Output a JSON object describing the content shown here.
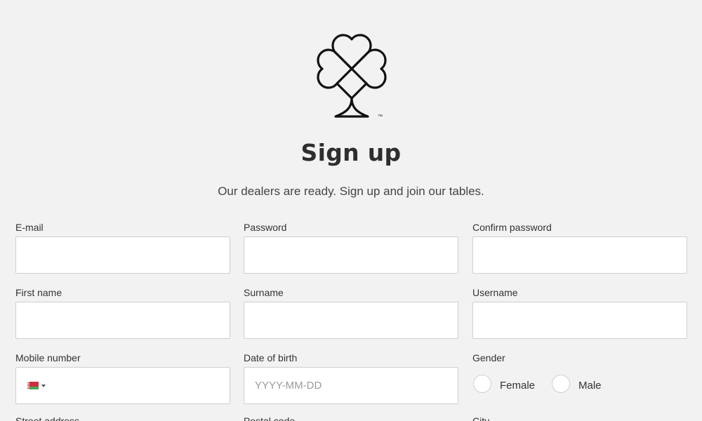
{
  "logo": {
    "icon": "spade-clover-logo",
    "trademark": "™"
  },
  "header": {
    "title": "Sign up",
    "subtitle": "Our dealers are ready. Sign up and join our tables."
  },
  "form": {
    "email": {
      "label": "E-mail",
      "value": "",
      "placeholder": ""
    },
    "password": {
      "label": "Password",
      "value": "",
      "placeholder": ""
    },
    "confirm_password": {
      "label": "Confirm password",
      "value": "",
      "placeholder": ""
    },
    "first_name": {
      "label": "First name",
      "value": "",
      "placeholder": ""
    },
    "surname": {
      "label": "Surname",
      "value": "",
      "placeholder": ""
    },
    "username": {
      "label": "Username",
      "value": "",
      "placeholder": ""
    },
    "mobile": {
      "label": "Mobile number",
      "value": "",
      "country_flag": "belarus-flag-icon"
    },
    "date_of_birth": {
      "label": "Date of birth",
      "value": "",
      "placeholder": "YYYY-MM-DD"
    },
    "gender": {
      "label": "Gender",
      "options": [
        "Female",
        "Male"
      ],
      "selected": null
    },
    "partial_labels": [
      "Street address",
      "Postal code",
      "City"
    ]
  }
}
